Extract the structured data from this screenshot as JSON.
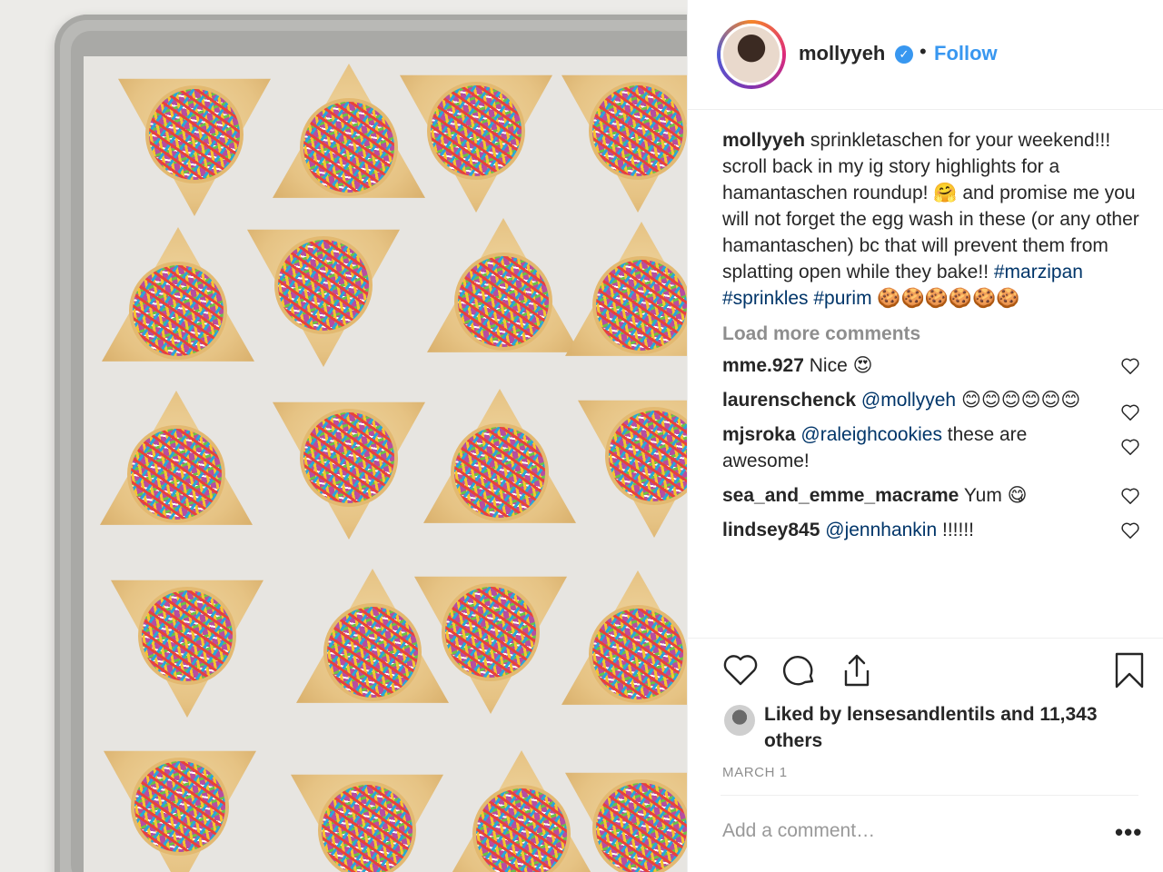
{
  "header": {
    "username": "mollyyeh",
    "verified_symbol": "✓",
    "separator": "•",
    "follow_label": "Follow"
  },
  "caption": {
    "username": "mollyyeh",
    "text": "sprinkletaschen for your weekend!!! scroll back in my ig story highlights for a hamantaschen roundup! 🤗 and promise me you will not forget the egg wash in these (or any other hamantaschen) bc that will prevent them from splatting open while they bake!!",
    "hashtags": "#marzipan #sprinkles #purim",
    "emojis": "🍪🍪🍪🍪🍪🍪"
  },
  "load_more": "Load more comments",
  "comments": [
    {
      "username": "mme.927",
      "mention": "",
      "text": "Nice 😍"
    },
    {
      "username": "laurenschenck",
      "mention": "@mollyyeh",
      "text": "😊😊😊😊😊😊"
    },
    {
      "username": "mjsroka",
      "mention": "@raleighcookies",
      "text": "these are awesome!"
    },
    {
      "username": "sea_and_emme_macrame",
      "mention": "",
      "text": "Yum 😋"
    },
    {
      "username": "lindsey845",
      "mention": "@jennhankin",
      "text": "!!!!!!"
    }
  ],
  "likes": {
    "text": "Liked by lensesandlentils and 11,343 others"
  },
  "date": "MARCH 1",
  "add_comment_placeholder": "Add a comment…",
  "more_options": "•••",
  "icons": {
    "like": "heart-icon",
    "comment": "comment-icon",
    "share": "share-icon",
    "save": "bookmark-icon"
  },
  "colors": {
    "link": "#3897f0",
    "hashtag": "#003569",
    "muted": "#8e8e8e",
    "text": "#262626"
  }
}
